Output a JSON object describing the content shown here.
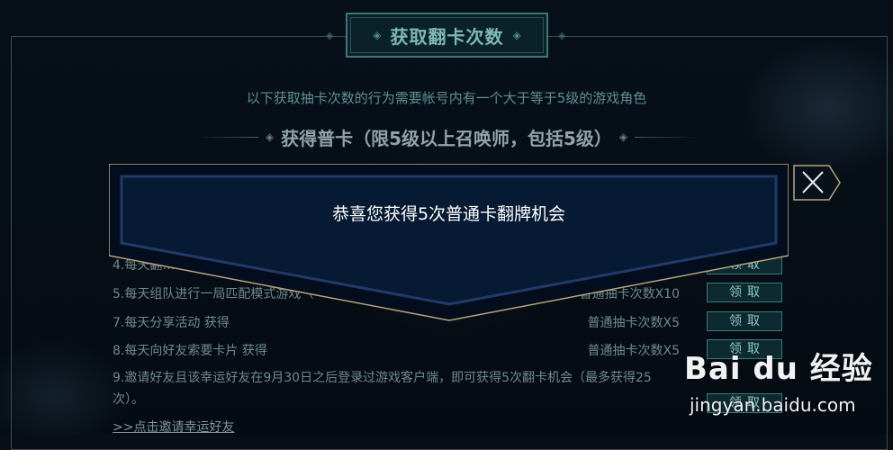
{
  "header": {
    "title": "获取翻卡次数"
  },
  "intro": {
    "subtitle": "以下获取抽卡次数的行为需要帐号内有一个大于等于5级的游戏角色",
    "section_heading": "获得普卡（限5级以上召唤师，包括5级）"
  },
  "tasks": [
    {
      "task": "4.每天翻…",
      "reward": "",
      "claim_label": "领取"
    },
    {
      "task": "5.每天组队进行一局匹配模式游戏（",
      "reward": "普通抽卡次数X10",
      "claim_label": "领取"
    },
    {
      "task": "7.每天分享活动 获得",
      "reward": "普通抽卡次数X5",
      "claim_label": "领取"
    },
    {
      "task": "8.每天向好友索要卡片 获得",
      "reward": "普通抽卡次数X5",
      "claim_label": "领取"
    }
  ],
  "invite": {
    "text": "9.邀请好友且该幸运好友在9月30日之后登录过游戏客户端，即可获得5次翻卡机会（最多获得25次）。",
    "claim_label": "领取",
    "link": ">>点击邀请幸运好友"
  },
  "modal": {
    "message": "恭喜您获得5次普通卡翻牌机会",
    "close_icon": "close-x-icon"
  },
  "watermark": {
    "logo": "Bai du 经验",
    "url": "jingyan.baidu.com"
  },
  "colors": {
    "accent": "#3d7777",
    "modal_border": "#b9a57e",
    "modal_bg": "#06152b"
  }
}
